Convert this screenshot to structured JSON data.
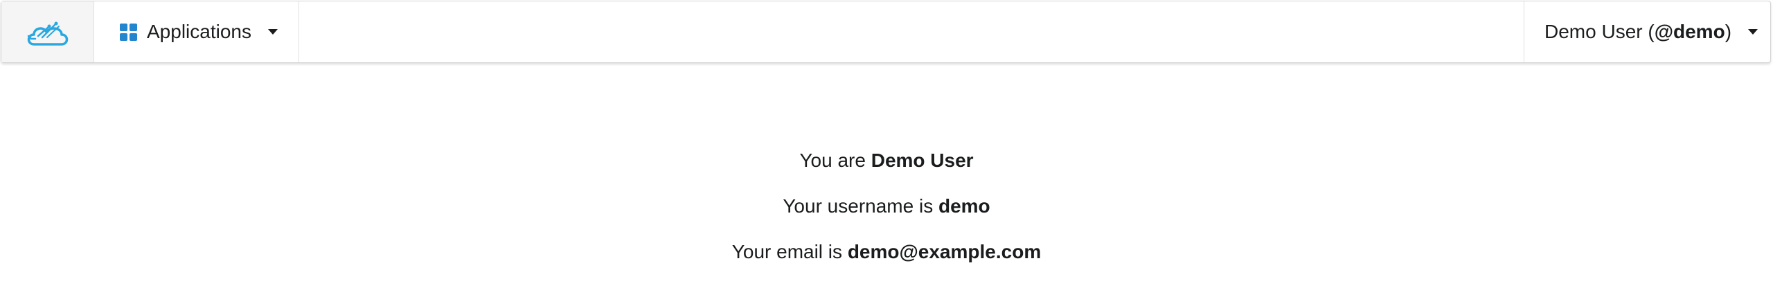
{
  "header": {
    "logo_icon": "cloud-logo-icon",
    "apps_icon": "grid-icon",
    "apps_label": "Applications",
    "user_display_name": "Demo User",
    "user_handle_open": "(",
    "user_handle": "@demo",
    "user_handle_close": ")",
    "caret_icon": "caret-down-icon"
  },
  "profile": {
    "line1_prefix": "You are ",
    "full_name": "Demo User",
    "line2_prefix": "Your username is ",
    "username": "demo",
    "line3_prefix": "Your email is ",
    "email": "demo@example.com"
  },
  "colors": {
    "accent": "#2185d0",
    "logo": "#29a8e0"
  }
}
